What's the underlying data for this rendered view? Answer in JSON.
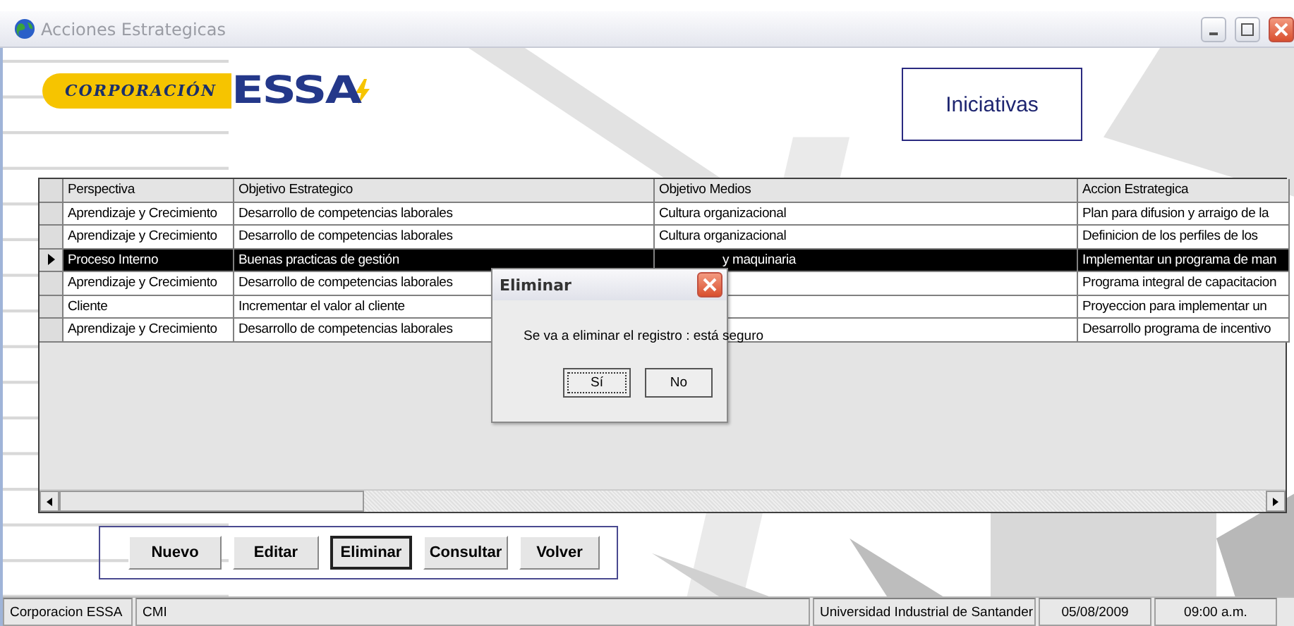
{
  "window": {
    "title": "Acciones Estrategicas"
  },
  "logo": {
    "name": "CORPORACIÓN",
    "brand": "ESSA"
  },
  "heading": "Iniciativas",
  "table": {
    "columns": [
      "Perspectiva",
      "Objetivo Estrategico",
      "Objetivo Medios",
      "Accion Estrategica"
    ],
    "rows": [
      {
        "selected": false,
        "perspectiva": "Aprendizaje y Crecimiento",
        "objetivo_estrategico": "Desarrollo de competencias laborales",
        "objetivo_medios": {
          "text": "Cultura organizacional",
          "partly_hidden": false
        },
        "accion": "Plan para difusion y arraigo de la"
      },
      {
        "selected": false,
        "perspectiva": "Aprendizaje y Crecimiento",
        "objetivo_estrategico": "Desarrollo de competencias laborales",
        "objetivo_medios": {
          "text": "Cultura organizacional",
          "partly_hidden": false
        },
        "accion": "Definicion de los perfiles de los"
      },
      {
        "selected": true,
        "perspectiva": "Proceso Interno",
        "objetivo_estrategico": "Buenas practicas de gestión",
        "objetivo_medios": {
          "text": "y maquinaria",
          "partly_hidden": true
        },
        "accion": "Implementar un programa de man"
      },
      {
        "selected": false,
        "perspectiva": "Aprendizaje y Crecimiento",
        "objetivo_estrategico": "Desarrollo de competencias laborales",
        "accion": "Programa integral de capacitacion"
      },
      {
        "selected": false,
        "perspectiva": "Cliente",
        "objetivo_estrategico": "Incrementar el valor al cliente",
        "accion": "Proyeccion para implementar un"
      },
      {
        "selected": false,
        "perspectiva": "Aprendizaje y Crecimiento",
        "objetivo_estrategico": "Desarrollo de competencias laborales",
        "accion": "Desarrollo programa  de incentivo"
      }
    ]
  },
  "buttons": [
    {
      "label": "Nuevo",
      "focused": false
    },
    {
      "label": "Editar",
      "focused": false
    },
    {
      "label": "Eliminar",
      "focused": true
    },
    {
      "label": "Consultar",
      "focused": false
    },
    {
      "label": "Volver",
      "focused": false
    }
  ],
  "dialog": {
    "title": "Eliminar",
    "message": "Se va a eliminar el registro : está seguro",
    "buttons": [
      {
        "label": "Sí",
        "focused": true
      },
      {
        "label": "No",
        "focused": false
      }
    ]
  },
  "status_bar": [
    "Corporacion ESSA",
    "CMI",
    "Universidad Industrial de Santander",
    "05/08/2009",
    "09:00 a.m."
  ]
}
